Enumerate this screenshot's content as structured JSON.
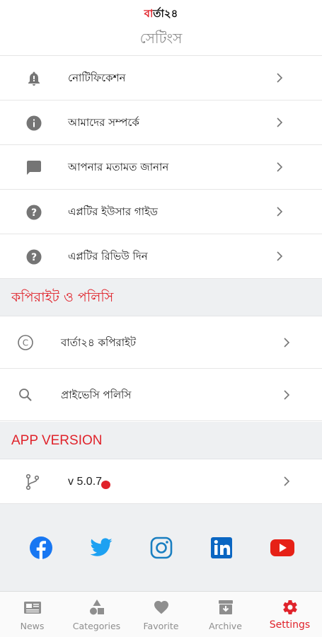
{
  "header": {
    "logo_mark": "ব",
    "logo_text": "ার্তা২৪",
    "title": "সেটিংস"
  },
  "menu": {
    "items": [
      {
        "label": "নোটিফিকেশন",
        "icon": "bell-icon"
      },
      {
        "label": "আমাদের সম্পর্কে",
        "icon": "info-icon"
      },
      {
        "label": "আপনার মতামত জানান",
        "icon": "feedback-icon"
      },
      {
        "label": "এপ্লটির ইউসার গাইড",
        "icon": "help-icon"
      },
      {
        "label": "এপ্লটির রিভিউ দিন",
        "icon": "help-icon"
      }
    ]
  },
  "copyright_section": {
    "title": "কপিরাইট ও পলিসি",
    "items": [
      {
        "label": "বার্তা২৪ কপিরাইট",
        "icon": "copyright-icon"
      },
      {
        "label": "প্রাইভেসি পলিসি",
        "icon": "search-icon"
      }
    ]
  },
  "version_section": {
    "title": "APP VERSION",
    "value": "v 5.0.7",
    "icon": "branch-icon"
  },
  "social": {
    "icons": [
      "facebook-icon",
      "twitter-icon",
      "instagram-icon",
      "linkedin-icon",
      "youtube-icon"
    ]
  },
  "tabbar": {
    "tabs": [
      {
        "label": "News",
        "icon": "newspaper-icon"
      },
      {
        "label": "Categories",
        "icon": "shapes-icon"
      },
      {
        "label": "Favorite",
        "icon": "heart-icon"
      },
      {
        "label": "Archive",
        "icon": "archive-icon"
      },
      {
        "label": "Settings",
        "icon": "gear-icon"
      }
    ],
    "active": "Settings"
  },
  "colors": {
    "accent": "#e0232b",
    "facebook": "#1877f2",
    "twitter": "#1da1f2",
    "linkedin": "#0a66c2",
    "youtube": "#e62117",
    "icon_gray": "#757575",
    "section_bg": "#eef0f2"
  }
}
